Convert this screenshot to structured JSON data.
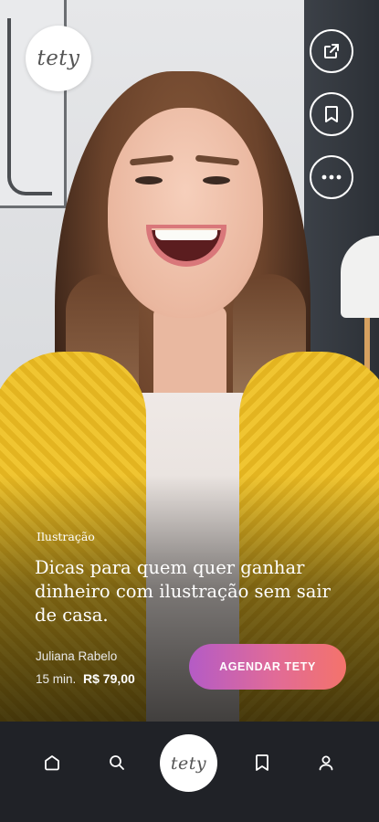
{
  "brand": {
    "logo_text": "tety"
  },
  "actions": {
    "share_icon": "share-external-icon",
    "bookmark_icon": "bookmark-icon",
    "more_icon": "more-horizontal-icon"
  },
  "card": {
    "category": "Ilustração",
    "title": "Dicas para quem quer ganhar dinheiro com ilustração sem sair de casa.",
    "author": "Juliana Rabelo",
    "duration": "15 min.",
    "price": "R$ 79,00",
    "cta_label": "AGENDAR TETY"
  },
  "nav": {
    "items": [
      {
        "icon": "home-icon"
      },
      {
        "icon": "search-icon"
      },
      {
        "label": "tety"
      },
      {
        "icon": "bookmark-icon"
      },
      {
        "icon": "profile-icon"
      }
    ]
  },
  "colors": {
    "cta_gradient_start": "#b45bc6",
    "cta_gradient_end": "#f4736b",
    "nav_background": "#202227"
  }
}
